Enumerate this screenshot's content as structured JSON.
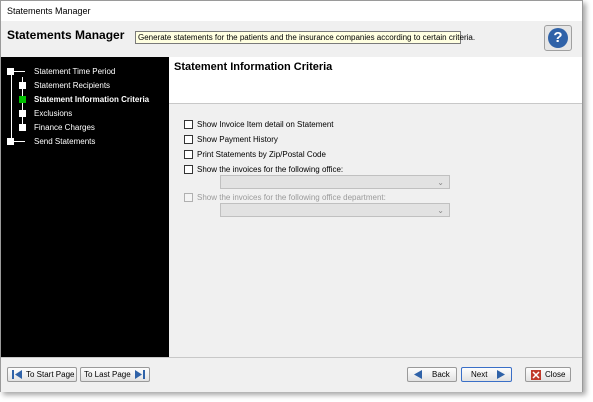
{
  "window": {
    "title": "Statements Manager"
  },
  "header": {
    "title": "Statements Manager",
    "description": "Generate statements for the patients and the insurance companies according to certain criteria.",
    "help_glyph": "?"
  },
  "sidebar": {
    "items": [
      {
        "label": "Statement Time Period"
      },
      {
        "label": "Statement Recipients"
      },
      {
        "label": "Statement Information Criteria"
      },
      {
        "label": "Exclusions"
      },
      {
        "label": "Finance Charges"
      },
      {
        "label": "Send Statements"
      }
    ],
    "active_index": 2,
    "active_color": "#00c000"
  },
  "content": {
    "title": "Statement Information Criteria",
    "options": [
      {
        "label": "Show Invoice Item detail on Statement",
        "checked": false,
        "enabled": true
      },
      {
        "label": "Show Payment History",
        "checked": false,
        "enabled": true
      },
      {
        "label": "Print Statements by Zip/Postal Code",
        "checked": false,
        "enabled": true
      },
      {
        "label": "Show the invoices for the following office:",
        "checked": false,
        "enabled": true
      },
      {
        "label": "Show the invoices for the following office department:",
        "checked": false,
        "enabled": false
      }
    ],
    "office_select": {
      "value": ""
    },
    "department_select": {
      "value": ""
    }
  },
  "footer": {
    "start_label": "To Start Page",
    "last_label": "To Last Page",
    "back_label": "Back",
    "next_label": "Next",
    "close_label": "Close"
  },
  "colors": {
    "sidebar_bg": "#000000",
    "accent_blue": "#2f62a8",
    "close_red": "#c0392b"
  }
}
